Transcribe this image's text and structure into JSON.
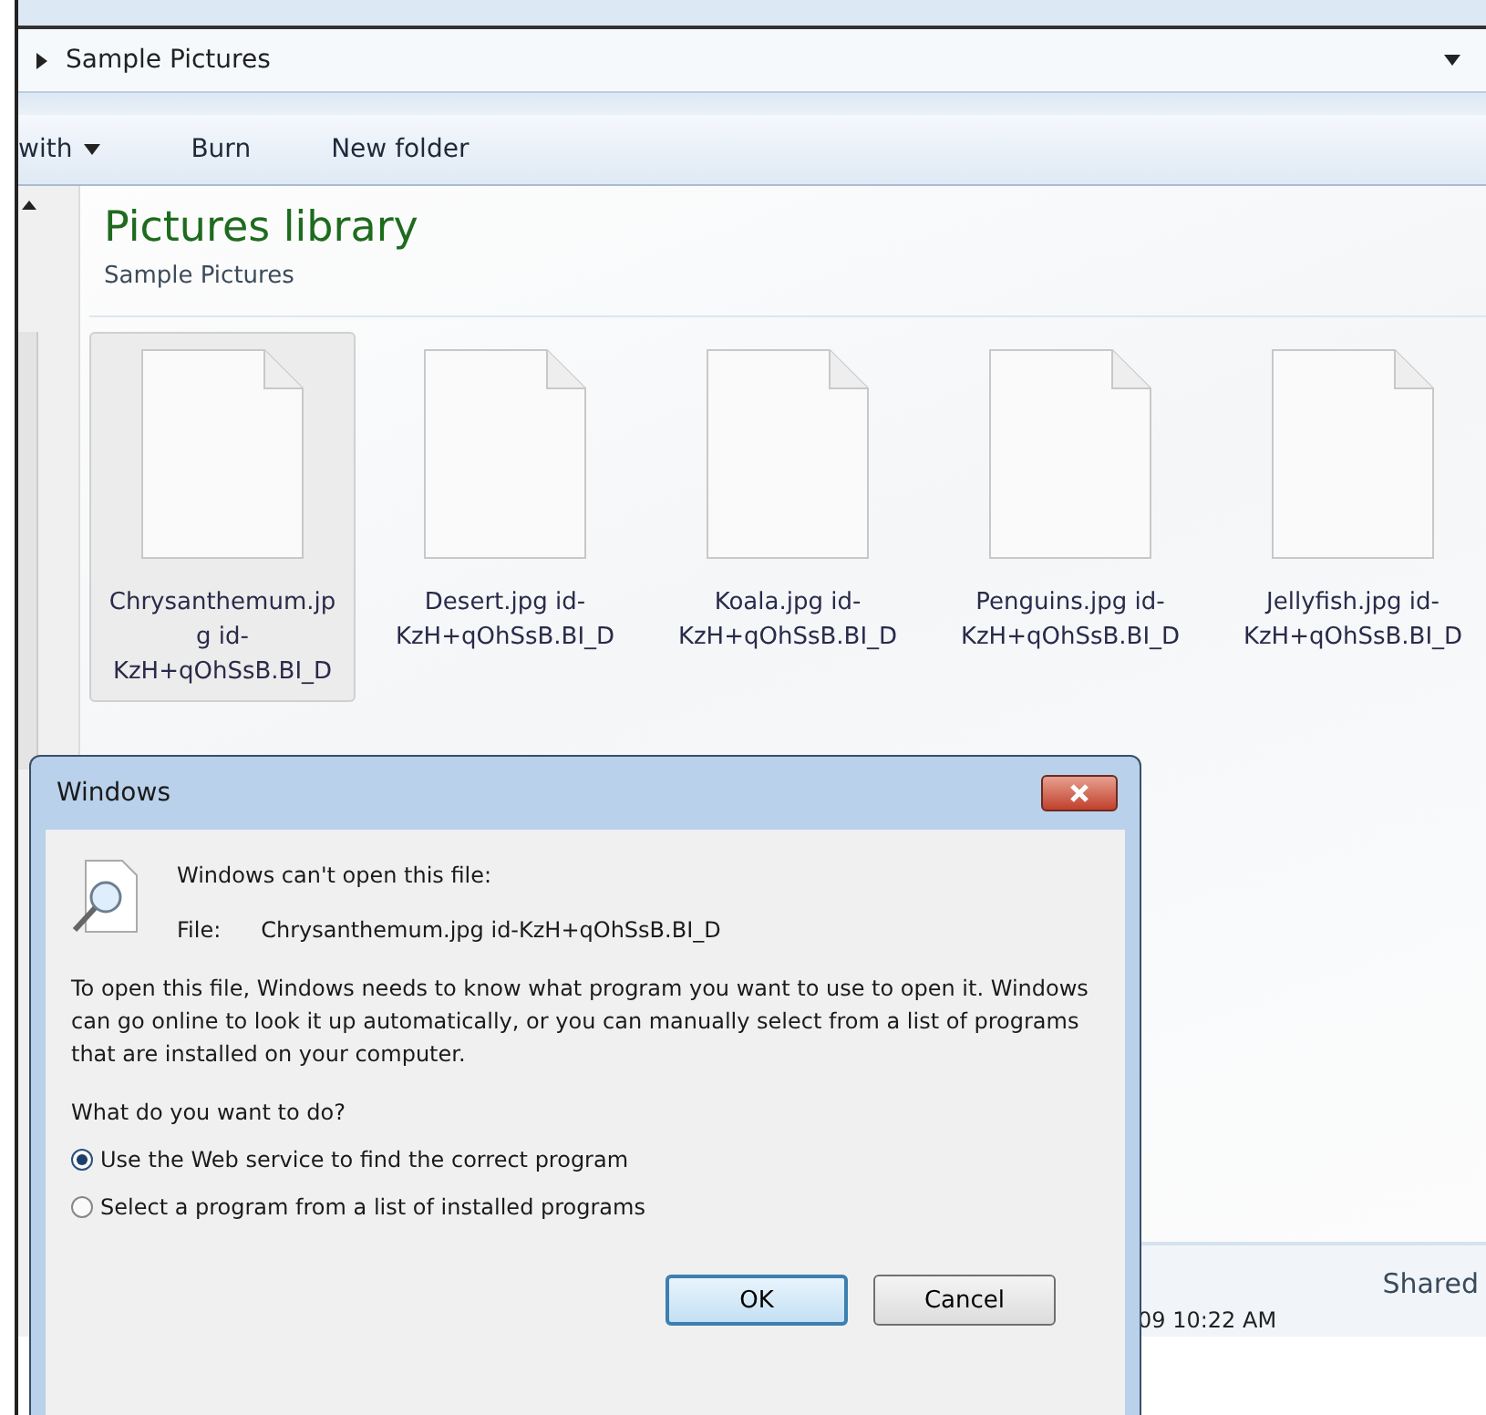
{
  "address_bar": {
    "path": "Sample Pictures"
  },
  "toolbar": {
    "items": [
      "with",
      "Burn",
      "New folder"
    ]
  },
  "library": {
    "title": "Pictures library",
    "subtitle": "Sample Pictures"
  },
  "files": [
    {
      "name": "Chrysanthemum.jpg id-KzH+qOhSsB.BI_D",
      "selected": true
    },
    {
      "name": "Desert.jpg id-KzH+qOhSsB.BI_D",
      "selected": false
    },
    {
      "name": "Koala.jpg id-KzH+qOhSsB.BI_D",
      "selected": false
    },
    {
      "name": "Penguins.jpg id-KzH+qOhSsB.BI_D",
      "selected": false
    },
    {
      "name": "Jellyfish.jpg id-KzH+qOhSsB.BI_D",
      "selected": false
    }
  ],
  "details": {
    "shared": "Shared",
    "date": "09 10:22 AM"
  },
  "dialog": {
    "title": "Windows",
    "heading": "Windows can't open this file:",
    "file_label": "File:",
    "file_name": "Chrysanthemum.jpg  id-KzH+qOhSsB.BI_D",
    "message": "To open this file, Windows needs to know what program you want to use to open it. Windows can go online to look it up automatically, or you can manually select from a list of programs that are installed on your computer.",
    "question": "What do you want to do?",
    "options": [
      {
        "label": "Use the Web service to find the correct program",
        "selected": true
      },
      {
        "label": "Select a program from a list of installed programs",
        "selected": false
      }
    ],
    "buttons": [
      {
        "label": "OK",
        "default": true
      },
      {
        "label": "Cancel",
        "default": false
      }
    ]
  }
}
